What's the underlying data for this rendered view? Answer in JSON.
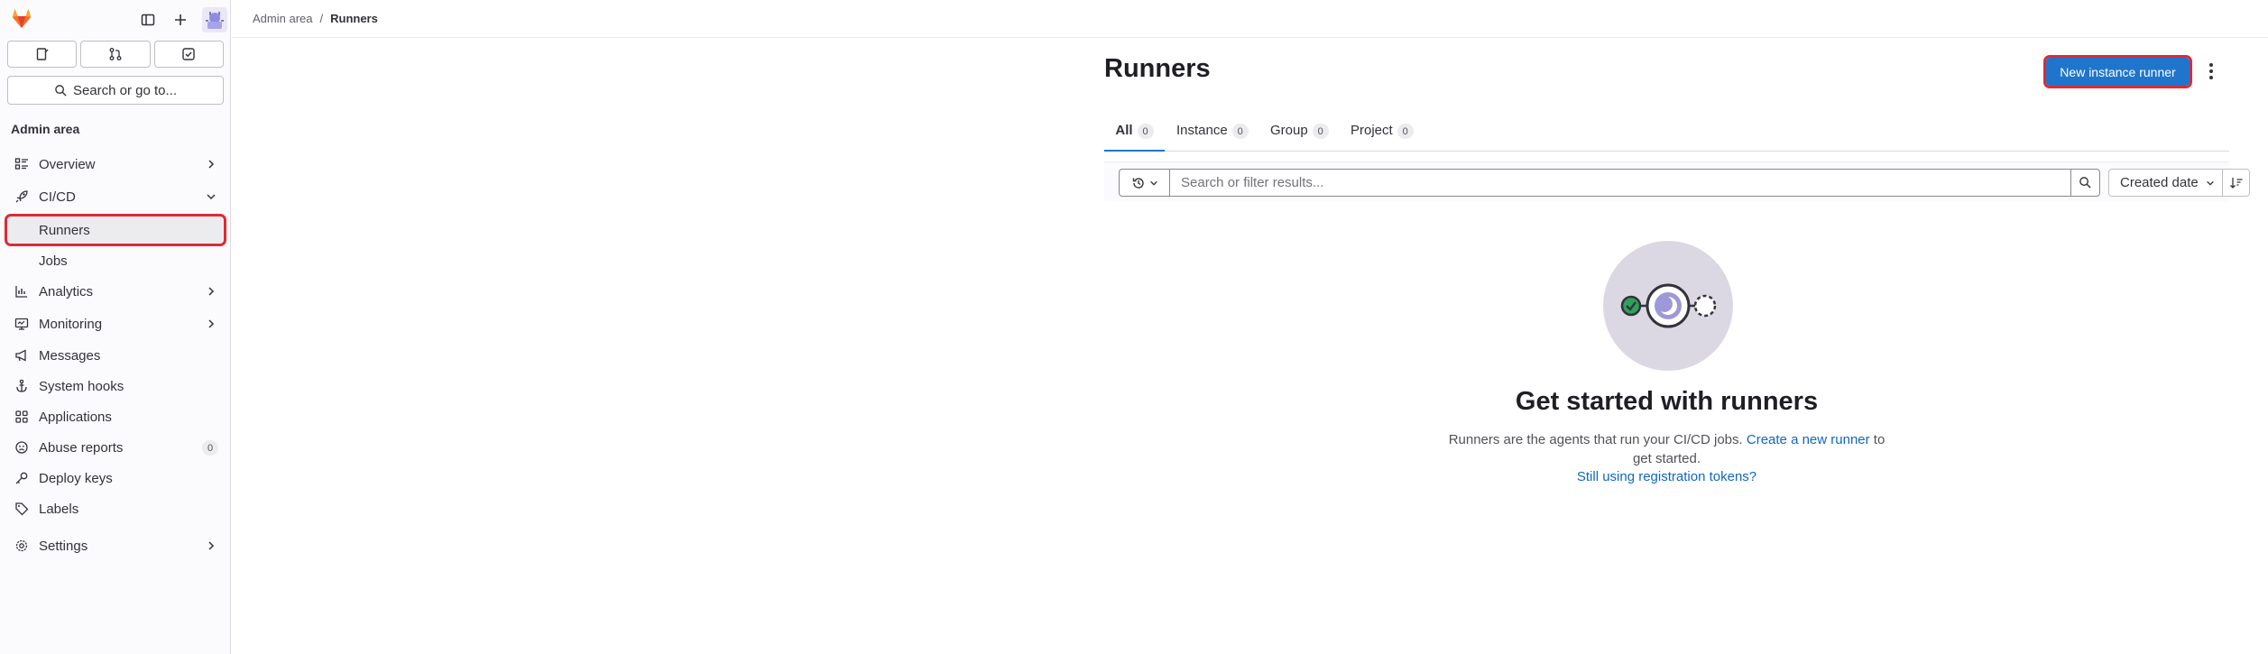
{
  "breadcrumb": {
    "parent": "Admin area",
    "separator": "/",
    "current": "Runners"
  },
  "sidebar": {
    "search_label": "Search or go to...",
    "section_title": "Admin area",
    "items": [
      {
        "label": "Overview",
        "icon": "overview-icon",
        "has_chevron": true
      },
      {
        "label": "CI/CD",
        "icon": "rocket-icon",
        "expanded": true
      },
      {
        "label": "Runners",
        "sub": true,
        "active": true
      },
      {
        "label": "Jobs",
        "sub": true
      },
      {
        "label": "Analytics",
        "icon": "chart-icon",
        "has_chevron": true
      },
      {
        "label": "Monitoring",
        "icon": "monitor-icon",
        "has_chevron": true
      },
      {
        "label": "Messages",
        "icon": "bullhorn-icon"
      },
      {
        "label": "System hooks",
        "icon": "anchor-icon"
      },
      {
        "label": "Applications",
        "icon": "applications-icon"
      },
      {
        "label": "Abuse reports",
        "icon": "abuse-icon",
        "count": "0"
      },
      {
        "label": "Deploy keys",
        "icon": "key-icon"
      },
      {
        "label": "Labels",
        "icon": "label-icon"
      },
      {
        "label": "Settings",
        "icon": "gear-icon",
        "has_chevron": true
      }
    ]
  },
  "header": {
    "title": "Runners",
    "new_runner_label": "New instance runner"
  },
  "tabs": [
    {
      "label": "All",
      "count": "0",
      "active": true
    },
    {
      "label": "Instance",
      "count": "0"
    },
    {
      "label": "Group",
      "count": "0"
    },
    {
      "label": "Project",
      "count": "0"
    }
  ],
  "filter": {
    "placeholder": "Search or filter results...",
    "sort_label": "Created date"
  },
  "empty_state": {
    "title": "Get started with runners",
    "text_before": "Runners are the agents that run your CI/CD jobs.",
    "link_text": "Create a new runner",
    "text_after": "to get started.",
    "secondary_link": "Still using registration tokens?"
  },
  "colors": {
    "accent": "#1f75cb",
    "highlight_outline": "#dd2b36",
    "link": "#1068bf",
    "illustration_bg": "#dbd8e3"
  }
}
